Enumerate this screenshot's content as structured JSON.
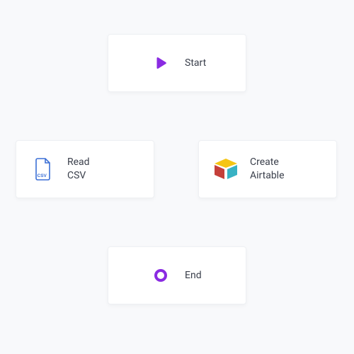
{
  "nodes": {
    "start": {
      "label": "Start"
    },
    "read_csv": {
      "label": "Read\nCSV"
    },
    "create_airtable": {
      "label": "Create\nAirtable"
    },
    "end": {
      "label": "End"
    }
  },
  "colors": {
    "purple": "#8a2be2",
    "csv_blue": "#3b6fd6",
    "air_yellow": "#f5c514",
    "air_red": "#c5403a",
    "air_cyan": "#38b2c4"
  }
}
